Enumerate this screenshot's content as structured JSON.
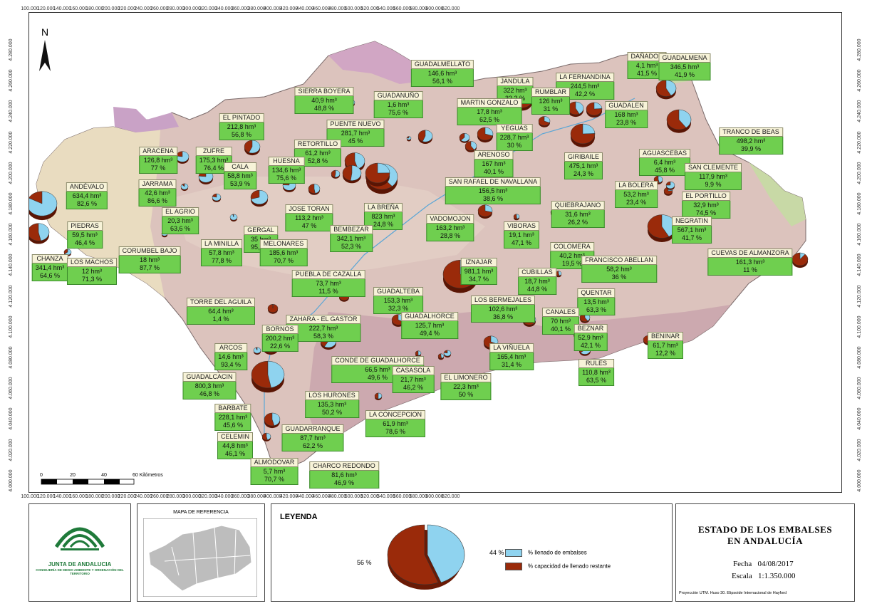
{
  "map": {
    "x_ticks": [
      "100.000",
      "120.000",
      "140.000",
      "160.000",
      "180.000",
      "200.000",
      "220.000",
      "240.000",
      "260.000",
      "280.000",
      "300.000",
      "320.000",
      "340.000",
      "360.000",
      "380.000",
      "400.000",
      "420.000",
      "440.000",
      "460.000",
      "480.000",
      "500.000",
      "520.000",
      "540.000",
      "560.000",
      "580.000",
      "600.000",
      "620.000"
    ],
    "y_ticks": [
      "4.280.000",
      "4.260.000",
      "4.240.000",
      "4.220.000",
      "4.200.000",
      "4.180.000",
      "4.160.000",
      "4.140.000",
      "4.120.000",
      "4.100.000",
      "4.080.000",
      "4.060.000",
      "4.040.000",
      "4.020.000",
      "4.000.000"
    ],
    "north_arrow": "N",
    "scale_bar": {
      "labels": [
        "0",
        "20",
        "40",
        "60 Kilómetros"
      ]
    },
    "colors": {
      "filled": "#8fd3ef",
      "remaining": "#9a2a0a",
      "label_bg": "#f7f3d8",
      "value_bg": "#6fcf4f"
    },
    "reservoirs": [
      {
        "name": "DAÑADOR",
        "volume": "4,1 hm³",
        "percent": "41,5 %"
      },
      {
        "name": "GUADALMENA",
        "volume": "346,5 hm³",
        "percent": "41,9 %"
      },
      {
        "name": "GUADALMELLATO",
        "volume": "146,6 hm³",
        "percent": "56,1 %"
      },
      {
        "name": "JANDULA",
        "volume": "322 hm³",
        "percent": "32,2 %"
      },
      {
        "name": "LA FERNANDINA",
        "volume": "244,5 hm³",
        "percent": "42,2 %"
      },
      {
        "name": "RUMBLAR",
        "volume": "126 hm³",
        "percent": "31 %"
      },
      {
        "name": "SIERRA BOYERA",
        "volume": "40,9 hm³",
        "percent": "48,8 %"
      },
      {
        "name": "GUADANUÑO",
        "volume": "1,6 hm³",
        "percent": "75,6 %"
      },
      {
        "name": "MARTIN GONZALO",
        "volume": "17,8 hm³",
        "percent": "62,5 %"
      },
      {
        "name": "GUADALEN",
        "volume": "168 hm³",
        "percent": "23,8 %"
      },
      {
        "name": "EL PINTADO",
        "volume": "212,8 hm³",
        "percent": "56,8 %"
      },
      {
        "name": "PUENTE NUEVO",
        "volume": "281,7 hm³",
        "percent": "45 %"
      },
      {
        "name": "YEGUAS",
        "volume": "228,7 hm³",
        "percent": "30 %"
      },
      {
        "name": "TRANCO DE BEAS",
        "volume": "498,2 hm³",
        "percent": "39,9 %"
      },
      {
        "name": "ARACENA",
        "volume": "126,8 hm³",
        "percent": "77 %"
      },
      {
        "name": "ZUFRE",
        "volume": "175,3 hm³",
        "percent": "76,4 %"
      },
      {
        "name": "RETORTILLO",
        "volume": "61,2 hm³",
        "percent": "52,8 %"
      },
      {
        "name": "ARENOSO",
        "volume": "167 hm³",
        "percent": "40,1 %"
      },
      {
        "name": "GIRIBAILE",
        "volume": "475,1 hm³",
        "percent": "24,3 %"
      },
      {
        "name": "AGUASCEBAS",
        "volume": "6,4 hm³",
        "percent": "45,8 %"
      },
      {
        "name": "HUESNA",
        "volume": "134,6 hm³",
        "percent": "75,6 %"
      },
      {
        "name": "CALA",
        "volume": "58,8 hm³",
        "percent": "53,9 %"
      },
      {
        "name": "SAN CLEMENTE",
        "volume": "117,9 hm³",
        "percent": "9,9 %"
      },
      {
        "name": "ANDÉVALO",
        "volume": "634,4 hm³",
        "percent": "82,6 %"
      },
      {
        "name": "JARRAMA",
        "volume": "42,6 hm³",
        "percent": "86,6 %"
      },
      {
        "name": "SAN RAFAEL DE NAVALLANA",
        "volume": "156,5 hm³",
        "percent": "38,6 %"
      },
      {
        "name": "LA BOLERA",
        "volume": "53,2 hm³",
        "percent": "23,4 %"
      },
      {
        "name": "EL PORTILLO",
        "volume": "32,9 hm³",
        "percent": "74,5 %"
      },
      {
        "name": "EL AGRIO",
        "volume": "20,3 hm³",
        "percent": "63,6 %"
      },
      {
        "name": "JOSE TORAN",
        "volume": "113,2 hm³",
        "percent": "47 %"
      },
      {
        "name": "LA BREÑA",
        "volume": "823 hm³",
        "percent": "24,8 %"
      },
      {
        "name": "QUIEBRAJANO",
        "volume": "31,6 hm³",
        "percent": "26,2 %"
      },
      {
        "name": "VADOMOJON",
        "volume": "163,2 hm³",
        "percent": "28,8 %"
      },
      {
        "name": "PIEDRAS",
        "volume": "59,5 hm³",
        "percent": "46,4 %"
      },
      {
        "name": "GERGAL",
        "volume": "35 hm³",
        "percent": "95,5 %"
      },
      {
        "name": "BEMBEZAR",
        "volume": "342,1 hm³",
        "percent": "52,3 %"
      },
      {
        "name": "VIBORAS",
        "volume": "19,1 hm³",
        "percent": "47,1 %"
      },
      {
        "name": "NEGRATIN",
        "volume": "567,1 hm³",
        "percent": "41,7 %"
      },
      {
        "name": "LA MINILLA",
        "volume": "57,8 hm³",
        "percent": "77,8 %"
      },
      {
        "name": "MELONARES",
        "volume": "185,6 hm³",
        "percent": "70,7 %"
      },
      {
        "name": "COLOMERA",
        "volume": "40,2 hm³",
        "percent": "19,5 %"
      },
      {
        "name": "CORUMBEL BAJO",
        "volume": "18 hm³",
        "percent": "87,7 %"
      },
      {
        "name": "CUEVAS DE ALMANZORA",
        "volume": "161,3 hm³",
        "percent": "11 %"
      },
      {
        "name": "CHANZA",
        "volume": "341,4 hm³",
        "percent": "64,6 %"
      },
      {
        "name": "LOS MACHOS",
        "volume": "12 hm³",
        "percent": "71,3 %"
      },
      {
        "name": "IZNAJAR",
        "volume": "981,1 hm³",
        "percent": "34,7 %"
      },
      {
        "name": "FRANCISCO ABELLAN",
        "volume": "58,2 hm³",
        "percent": "36 %"
      },
      {
        "name": "CUBILLAS",
        "volume": "18,7 hm³",
        "percent": "44,8 %"
      },
      {
        "name": "PUEBLA DE CAZALLA",
        "volume": "73,7 hm³",
        "percent": "11,5 %"
      },
      {
        "name": "GUADALTEBA",
        "volume": "153,3 hm³",
        "percent": "32,3 %"
      },
      {
        "name": "LOS BERMEJALES",
        "volume": "102,6 hm³",
        "percent": "36,8 %"
      },
      {
        "name": "QUENTAR",
        "volume": "13,5 hm³",
        "percent": "63,3 %"
      },
      {
        "name": "TORRE DEL AGUILA",
        "volume": "64,4 hm³",
        "percent": "1,4 %"
      },
      {
        "name": "CANALES",
        "volume": "70 hm³",
        "percent": "40,1 %"
      },
      {
        "name": "ZAHARA - EL GASTOR",
        "volume": "222,7 hm³",
        "percent": "58,3 %"
      },
      {
        "name": "GUADALHORCE",
        "volume": "125,7 hm³",
        "percent": "49,4 %"
      },
      {
        "name": "BEZNAR",
        "volume": "52,9 hm³",
        "percent": "42,1 %"
      },
      {
        "name": "BORNOS",
        "volume": "200,2 hm³",
        "percent": "22,6 %"
      },
      {
        "name": "BENINAR",
        "volume": "61,7 hm³",
        "percent": "12,2 %"
      },
      {
        "name": "ARCOS",
        "volume": "14,6 hm³",
        "percent": "93,4 %"
      },
      {
        "name": "LA VIÑUELA",
        "volume": "165,4 hm³",
        "percent": "31,4 %"
      },
      {
        "name": "CONDE DE GUADALHORCE",
        "volume": "66,5 hm³",
        "percent": "49,6 %"
      },
      {
        "name": "RULES",
        "volume": "110,8 hm³",
        "percent": "63,5 %"
      },
      {
        "name": "GUADALCACIN",
        "volume": "800,3 hm³",
        "percent": "46,8 %"
      },
      {
        "name": "CASASOLA",
        "volume": "21,7 hm³",
        "percent": "46,2 %"
      },
      {
        "name": "EL LIMONERO",
        "volume": "22,3 hm³",
        "percent": "50 %"
      },
      {
        "name": "LOS HURONES",
        "volume": "135,3 hm³",
        "percent": "50,2 %"
      },
      {
        "name": "BARBATE",
        "volume": "228,1 hm³",
        "percent": "45,6 %"
      },
      {
        "name": "LA CONCEPCION",
        "volume": "61,9 hm³",
        "percent": "78,6 %"
      },
      {
        "name": "GUADARRANQUE",
        "volume": "87,7 hm³",
        "percent": "62,2 %"
      },
      {
        "name": "CELEMIN",
        "volume": "44,8 hm³",
        "percent": "46,1 %"
      },
      {
        "name": "ALMODOVAR",
        "volume": "5,7 hm³",
        "percent": "70,7 %"
      },
      {
        "name": "CHARCO REDONDO",
        "volume": "81,6 hm³",
        "percent": "46,9 %"
      }
    ]
  },
  "logo": {
    "name": "JUNTA DE ANDALUCIA",
    "department": "CONSEJERÍA DE MEDIO AMBIENTE Y ORDENACIÓN DEL TERRITORIO"
  },
  "reference_map": {
    "title": "MAPA DE REFERENCIA"
  },
  "legend": {
    "title": "LEYENDA",
    "filled_label": "% llenado de embalses",
    "remaining_label": "% capacidad de llenado restante",
    "filled_pct": "44 %",
    "remaining_pct": "56 %",
    "filled_value": 44,
    "remaining_value": 56
  },
  "title_block": {
    "line1": "ESTADO DE LOS EMBALSES",
    "line2": "EN ANDALUCÍA",
    "date_label": "Fecha",
    "date": "04/08/2017",
    "scale_label": "Escala",
    "scale": "1:1.350.000",
    "projection": "Proyección UTM. Huso 30. Elipsoide Internacional de Hayford"
  }
}
